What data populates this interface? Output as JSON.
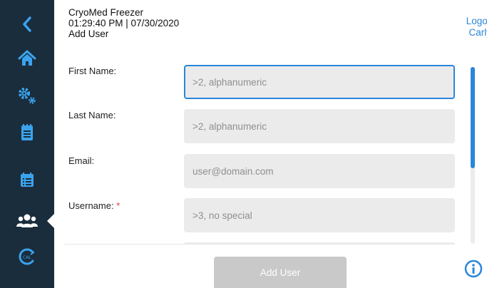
{
  "header": {
    "app_title": "CryoMed Freezer",
    "datetime": "01:29:40 PM | 07/30/2020",
    "page_title": "Add User",
    "logout_label": "Logout",
    "user_name": "Carly"
  },
  "sidebar": {
    "items": [
      {
        "icon": "chevron-left-icon"
      },
      {
        "icon": "home-icon"
      },
      {
        "icon": "gears-icon"
      },
      {
        "icon": "clipboard-icon"
      },
      {
        "icon": "calendar-list-icon"
      },
      {
        "icon": "users-icon",
        "active": true
      },
      {
        "icon": "calibration-icon"
      }
    ]
  },
  "form": {
    "first_name": {
      "label": "First Name:",
      "placeholder": ">2, alphanumeric",
      "value": ""
    },
    "last_name": {
      "label": "Last Name:",
      "placeholder": ">2, alphanumeric",
      "value": ""
    },
    "email": {
      "label": "Email:",
      "placeholder": "user@domain.com",
      "value": ""
    },
    "username": {
      "label": "Username:",
      "required_mark": "*",
      "placeholder": ">3, no special",
      "value": ""
    }
  },
  "actions": {
    "add_user_label": "Add User"
  },
  "colors": {
    "sidebar_bg": "#1a2d3c",
    "accent": "#2a86d9",
    "required": "#e23b3b",
    "disabled_button": "#c9c9c9"
  }
}
